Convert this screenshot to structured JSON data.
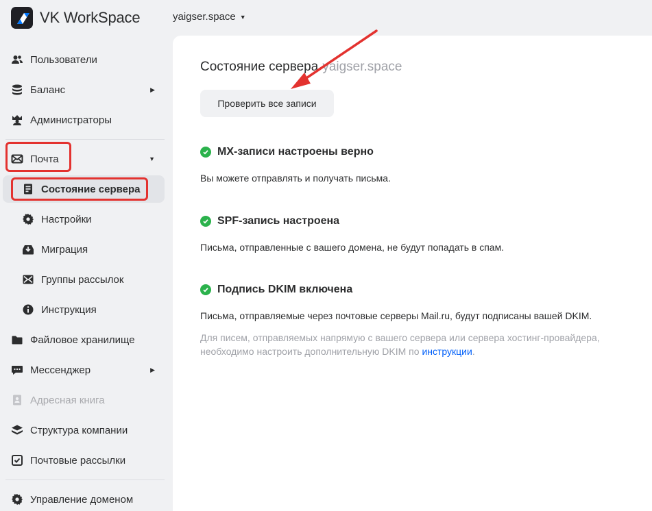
{
  "app": {
    "brand": "VK WorkSpace",
    "domain": "yaigser.space"
  },
  "sidebar": {
    "items": [
      {
        "label": "Пользователи",
        "icon": "users-icon"
      },
      {
        "label": "Баланс",
        "icon": "coins-icon"
      },
      {
        "label": "Администраторы",
        "icon": "admin-icon"
      },
      {
        "label": "Почта",
        "icon": "mail-icon"
      },
      {
        "label": "Состояние сервера",
        "icon": "server-status-icon"
      },
      {
        "label": "Настройки",
        "icon": "gear-icon"
      },
      {
        "label": "Миграция",
        "icon": "migration-icon"
      },
      {
        "label": "Группы рассылок",
        "icon": "mailing-groups-icon"
      },
      {
        "label": "Инструкция",
        "icon": "info-icon"
      },
      {
        "label": "Файловое хранилище",
        "icon": "folder-icon"
      },
      {
        "label": "Мессенджер",
        "icon": "chat-icon"
      },
      {
        "label": "Адресная книга",
        "icon": "address-book-icon"
      },
      {
        "label": "Структура компании",
        "icon": "layers-icon"
      },
      {
        "label": "Почтовые рассылки",
        "icon": "checkbox-icon"
      },
      {
        "label": "Управление доменом",
        "icon": "gear-icon"
      }
    ]
  },
  "main": {
    "title": "Состояние сервера",
    "title_domain": "yaigser.space",
    "check_button": "Проверить все записи",
    "checks": [
      {
        "title": "MX-записи настроены верно",
        "desc": "Вы можете отправлять и получать письма."
      },
      {
        "title": "SPF-запись настроена",
        "desc": "Письма, отправленные с вашего домена, не будут попадать в спам."
      },
      {
        "title": "Подпись DKIM включена",
        "desc": "Письма, отправляемые через почтовые серверы Mail.ru, будут подписаны вашей DKIM.",
        "note": "Для писем, отправляемых напрямую с вашего сервера или сервера хостинг-провайдера, необходимо настроить дополнительную DKIM по",
        "note_link": "инструкции",
        "note_end": "."
      }
    ]
  },
  "colors": {
    "accent_red": "#e3322f",
    "ok_green": "#2bb24c",
    "link_blue": "#005ff9"
  }
}
